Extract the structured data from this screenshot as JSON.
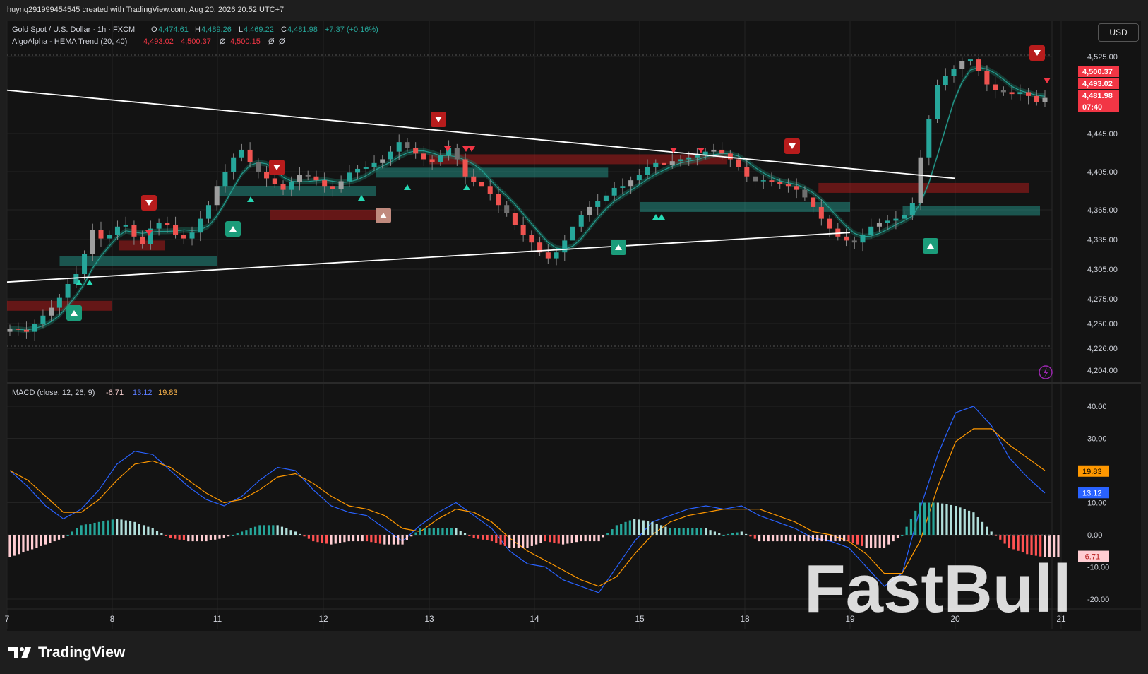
{
  "header": {
    "created_text": "huynq291999454545 created with TradingView.com, Aug 20, 2026 20:52 UTC+7"
  },
  "legend": {
    "symbol": "Gold Spot / U.S. Dollar · 1h · FXCM",
    "o_label": "O",
    "o": "4,474.61",
    "h_label": "H",
    "h": "4,489.26",
    "l_label": "L",
    "l": "4,469.22",
    "c_label": "C",
    "c": "4,481.98",
    "change": "+7.37 (+0.16%)",
    "indicator": "AlgoAlpha - HEMA Trend (20, 40)",
    "ind_v1": "4,493.02",
    "ind_v2": "4,500.37",
    "ind_sym1": "Ø",
    "ind_v3": "4,500.15",
    "ind_sym2": "Ø",
    "ind_sym3": "Ø",
    "macd": "MACD (close, 12, 26, 9)",
    "macd_hist": "-6.71",
    "macd_line": "13.12",
    "macd_signal": "19.83"
  },
  "currency_button": "USD",
  "colors": {
    "up": "#26a69a",
    "down": "#ef5350",
    "macd": "#2962ff",
    "signal": "#ff9800",
    "background": "#131313",
    "price_tag": "#f23645"
  },
  "icons": {
    "brand_logo": "tradingview-logo-icon",
    "alert": "lightning-icon"
  },
  "watermark": "FastBull",
  "brand": "TradingView",
  "price_tags": [
    {
      "label": "4,500.37"
    },
    {
      "label": "4,493.02"
    },
    {
      "label": "4,481.98"
    },
    {
      "label": "07:40"
    }
  ],
  "macd_tags": [
    {
      "label": "19.83"
    },
    {
      "label": "13.12"
    },
    {
      "label": "-6.71"
    }
  ],
  "chart_data": [
    {
      "type": "candlestick",
      "title": "Gold Spot / U.S. Dollar · 1h · FXCM",
      "x_ticks": [
        "7",
        "8",
        "11",
        "12",
        "13",
        "14",
        "15",
        "18",
        "19",
        "20",
        "21"
      ],
      "y_ticks": [
        "4,525.00",
        "4,445.00",
        "4,405.00",
        "4,365.00",
        "4,335.00",
        "4,305.00",
        "4,275.00",
        "4,250.00",
        "4,226.00",
        "4,204.00"
      ],
      "ylim": [
        4204,
        4535
      ],
      "close_path": [
        4245,
        4244,
        4242,
        4250,
        4258,
        4266,
        4276,
        4290,
        4300,
        4320,
        4345,
        4336,
        4340,
        4348,
        4350,
        4338,
        4330,
        4346,
        4352,
        4350,
        4340,
        4336,
        4342,
        4356,
        4370,
        4390,
        4405,
        4420,
        4428,
        4415,
        4405,
        4398,
        4392,
        4386,
        4394,
        4402,
        4400,
        4396,
        4390,
        4387,
        4395,
        4404,
        4408,
        4410,
        4414,
        4418,
        4426,
        4436,
        4430,
        4424,
        4418,
        4415,
        4422,
        4430,
        4418,
        4400,
        4394,
        4390,
        4382,
        4370,
        4362,
        4350,
        4340,
        4332,
        4322,
        4316,
        4322,
        4334,
        4348,
        4360,
        4368,
        4374,
        4380,
        4388,
        4390,
        4396,
        4402,
        4410,
        4414,
        4412,
        4416,
        4418,
        4420,
        4422,
        4426,
        4428,
        4424,
        4418,
        4410,
        4400,
        4395,
        4396,
        4394,
        4392,
        4390,
        4386,
        4378,
        4368,
        4356,
        4346,
        4338,
        4334,
        4332,
        4340,
        4348,
        4352,
        4354,
        4356,
        4360,
        4372,
        4420,
        4460,
        4495,
        4505,
        4512,
        4520,
        4522,
        4510,
        4496,
        4490,
        4488,
        4486,
        4488,
        4484,
        4478,
        4482
      ],
      "buy_signals": [
        "8",
        "11",
        "12 (faded)",
        "14/15",
        "19/20"
      ],
      "sell_signals": [
        "8",
        "11",
        "13",
        "18",
        "20/21"
      ],
      "hema_trend": {
        "name": "AlgoAlpha - HEMA Trend (20, 40)",
        "last": [
          4493.02,
          4500.37,
          4500.15
        ]
      },
      "last_close": 4481.98,
      "trendlines": [
        {
          "from": [
            "7",
            4490
          ],
          "to": [
            "20",
            4398
          ]
        },
        {
          "from": [
            "7",
            4292
          ],
          "to": [
            "19",
            4342
          ]
        }
      ],
      "zones_up": [
        {
          "x": [
            "7.5",
            "11"
          ],
          "y": 4313
        },
        {
          "x": [
            "11",
            "12.5"
          ],
          "y": 4385
        },
        {
          "x": [
            "12.5",
            "14.7"
          ],
          "y": 4404
        },
        {
          "x": [
            "15",
            "19"
          ],
          "y": 4368
        },
        {
          "x": [
            "19.5",
            "20.8"
          ],
          "y": 4364
        }
      ],
      "zones_down": [
        {
          "x": [
            "7",
            "8"
          ],
          "y": 4268
        },
        {
          "x": [
            "8.2",
            "9.5"
          ],
          "y": 4329
        },
        {
          "x": [
            "11.5",
            "12.5"
          ],
          "y": 4360
        },
        {
          "x": [
            "13",
            "17.5"
          ],
          "y": 4418
        },
        {
          "x": [
            "18.7",
            "20.7"
          ],
          "y": 4388
        }
      ]
    },
    {
      "type": "line",
      "title": "MACD (close, 12, 26, 9)",
      "x_ticks": [
        "7",
        "8",
        "11",
        "12",
        "13",
        "14",
        "15",
        "18",
        "19",
        "20",
        "21"
      ],
      "y_ticks": [
        "40.00",
        "30.00",
        "10.00",
        "0.00",
        "-10.00",
        "-20.00"
      ],
      "ylim": [
        -24,
        44
      ],
      "series": [
        {
          "name": "MACD",
          "values": [
            20,
            15,
            9,
            5,
            8,
            14,
            22,
            26,
            25,
            20,
            15,
            11,
            9,
            12,
            17,
            21,
            20,
            14,
            9,
            7,
            6,
            2,
            -2,
            3,
            7,
            10,
            6,
            2,
            -5,
            -9,
            -10,
            -14,
            -16,
            -18,
            -10,
            -2,
            4,
            6,
            8,
            9,
            8,
            9,
            6,
            4,
            2,
            -1,
            -2,
            -4,
            -10,
            -16,
            -12,
            8,
            25,
            38,
            40,
            34,
            24,
            18,
            13
          ]
        },
        {
          "name": "Signal",
          "values": [
            20,
            17,
            12,
            7,
            7,
            11,
            17,
            22,
            23,
            21,
            17,
            13,
            10,
            11,
            14,
            18,
            19,
            16,
            12,
            9,
            8,
            6,
            2,
            1,
            5,
            8,
            7,
            4,
            -1,
            -5,
            -8,
            -11,
            -14,
            -16,
            -13,
            -6,
            0,
            4,
            6,
            7,
            8,
            8,
            8,
            6,
            4,
            1,
            0,
            -2,
            -6,
            -12,
            -12,
            -2,
            15,
            29,
            33,
            33,
            28,
            24,
            20
          ]
        },
        {
          "name": "Histogram",
          "values": [
            -7,
            -5,
            -3,
            -1,
            3,
            4,
            5,
            4,
            2,
            -1,
            -2,
            -2,
            -1,
            1,
            3,
            3,
            1,
            -2,
            -3,
            -2,
            -2,
            -3,
            -3,
            2,
            2,
            2,
            -1,
            -2,
            -4,
            -4,
            -2,
            -3,
            -2,
            -2,
            3,
            5,
            4,
            2,
            2,
            2,
            0,
            1,
            -2,
            -2,
            -2,
            -2,
            -2,
            -2,
            -4,
            -4,
            0,
            10,
            10,
            9,
            7,
            1,
            -4,
            -6,
            -7
          ]
        }
      ]
    }
  ]
}
